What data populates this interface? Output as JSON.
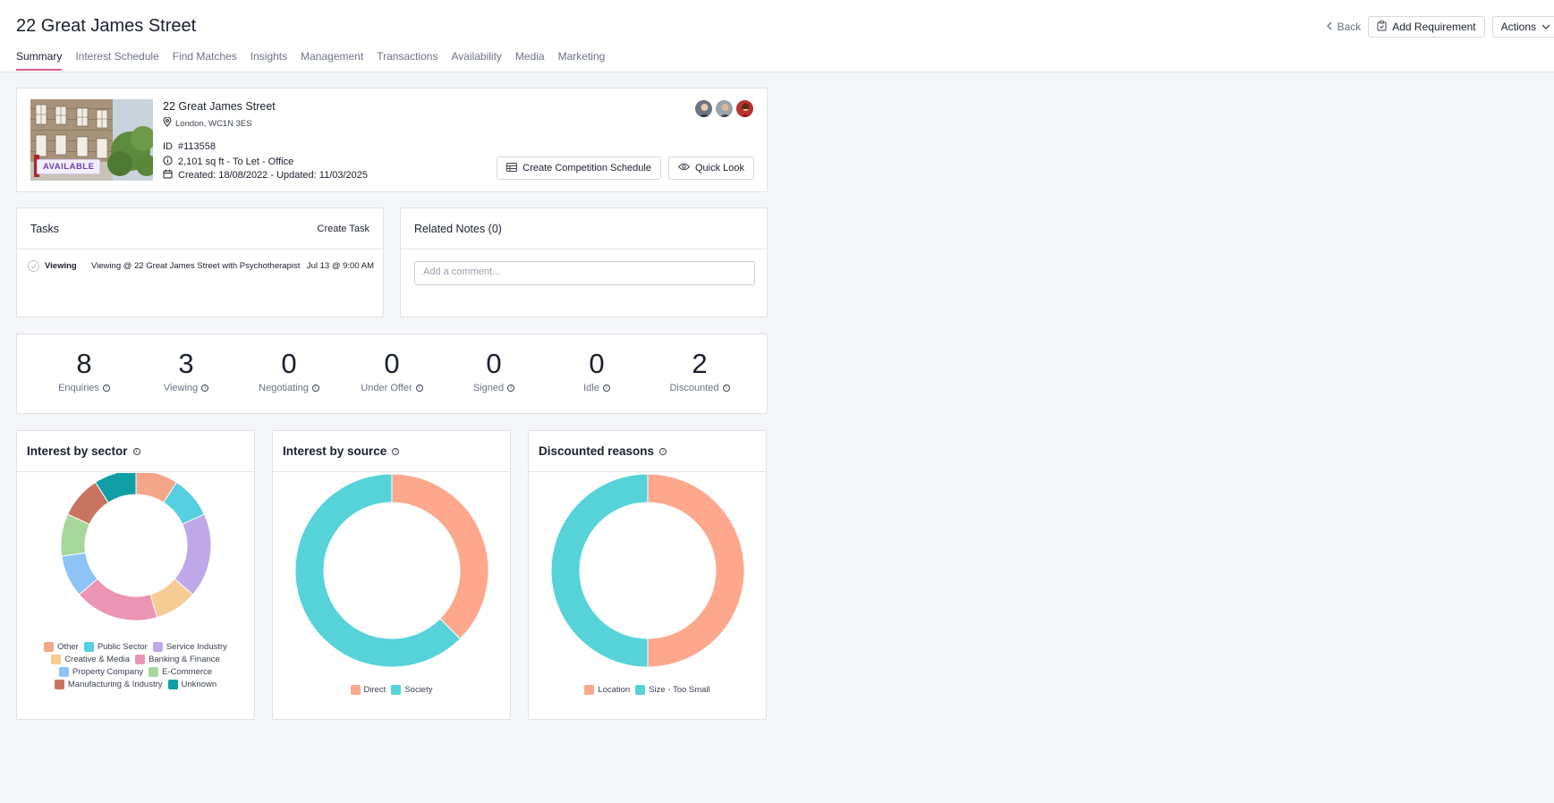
{
  "header": {
    "title": "22 Great James Street",
    "back_label": "Back",
    "add_requirement_label": "Add Requirement",
    "actions_label": "Actions",
    "tabs": [
      "Summary",
      "Interest Schedule",
      "Find Matches",
      "Insights",
      "Management",
      "Transactions",
      "Availability",
      "Media",
      "Marketing"
    ],
    "active_tab": "Summary"
  },
  "property": {
    "name": "22 Great James Street",
    "location": "London, WC1N 3ES",
    "id_label": "ID",
    "id_value": "#113558",
    "size_line": "2,101 sq ft - To Let - Office",
    "dates_line": "Created: 18/08/2022 - Updated: 11/03/2025",
    "status_badge": "AVAILABLE",
    "create_schedule_label": "Create Competition Schedule",
    "quick_look_label": "Quick Look"
  },
  "tasks": {
    "title": "Tasks",
    "create_label": "Create Task",
    "items": [
      {
        "type": "Viewing",
        "description": "Viewing @ 22 Great James Street with Psychotherapist",
        "date": "Jul 13 @ 9:00 AM"
      }
    ]
  },
  "notes": {
    "title": "Related Notes (0)",
    "placeholder": "Add a comment..."
  },
  "stats": [
    {
      "value": "8",
      "label": "Enquiries"
    },
    {
      "value": "3",
      "label": "Viewing"
    },
    {
      "value": "0",
      "label": "Negotiating"
    },
    {
      "value": "0",
      "label": "Under Offer"
    },
    {
      "value": "0",
      "label": "Signed"
    },
    {
      "value": "0",
      "label": "Idle"
    },
    {
      "value": "2",
      "label": "Discounted"
    }
  ],
  "colors": {
    "accent_tab": "#e15b8e",
    "salmon": "#fda88c",
    "cyan": "#55d3d9"
  },
  "chart_data": [
    {
      "type": "pie",
      "title": "Interest by sector",
      "categories": [
        "Other",
        "Public Sector",
        "Service Industry",
        "Creative & Media",
        "Banking & Finance",
        "Property Company",
        "E-Commerce",
        "Manufacturing & Industry",
        "Unknown"
      ],
      "values": [
        1,
        1,
        2,
        1,
        2,
        1,
        1,
        1,
        1
      ],
      "colors": [
        "#f5a58a",
        "#56cfe0",
        "#c0a8e8",
        "#f7cb94",
        "#ec94b4",
        "#8ec4f7",
        "#a6d69a",
        "#c97462",
        "#0f9ea4"
      ]
    },
    {
      "type": "pie",
      "title": "Interest by source",
      "categories": [
        "Direct",
        "Society"
      ],
      "values": [
        3,
        5
      ],
      "colors": [
        "#fda88c",
        "#55d3d9"
      ]
    },
    {
      "type": "pie",
      "title": "Discounted reasons",
      "categories": [
        "Location",
        "Size - Too Small"
      ],
      "values": [
        1,
        1
      ],
      "colors": [
        "#fda88c",
        "#55d3d9"
      ]
    }
  ]
}
